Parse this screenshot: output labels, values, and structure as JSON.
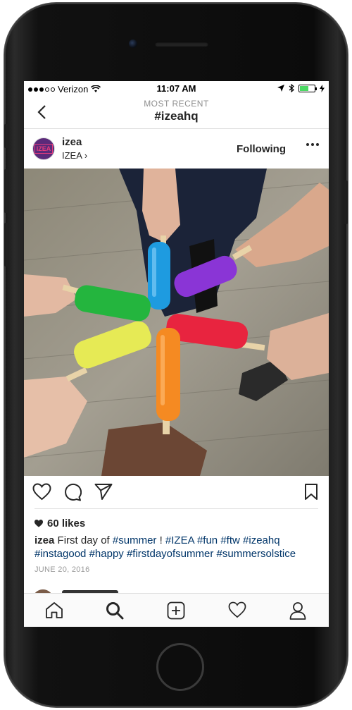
{
  "status_bar": {
    "carrier": "Verizon",
    "time": "11:07 AM",
    "battery_level": 0.6,
    "battery_color": "#4cd964"
  },
  "header": {
    "subtitle": "MOST RECENT",
    "title": "#izeahq",
    "back_icon": "chevron-left-icon"
  },
  "post": {
    "username": "izea",
    "location": "IZEA",
    "location_chevron": "›",
    "follow_label": "Following",
    "avatar_text": "IZEA",
    "likes": "60 likes",
    "caption_user": "izea",
    "caption_text": "First day of",
    "caption_parts": [
      {
        "text": "#summer",
        "tag": true
      },
      {
        "text": " ! ",
        "tag": false
      },
      {
        "text": "#IZEA",
        "tag": true
      },
      {
        "text": " ",
        "tag": false
      },
      {
        "text": "#fun",
        "tag": true
      },
      {
        "text": " ",
        "tag": false
      },
      {
        "text": "#ftw",
        "tag": true
      },
      {
        "text": " ",
        "tag": false
      },
      {
        "text": "#izeahq",
        "tag": true
      },
      {
        "text": " ",
        "tag": false
      },
      {
        "text": "#instagood",
        "tag": true
      },
      {
        "text": " ",
        "tag": false
      },
      {
        "text": "#happy",
        "tag": true
      },
      {
        "text": " ",
        "tag": false
      },
      {
        "text": "#firstdayofsummer",
        "tag": true
      },
      {
        "text": " ",
        "tag": false
      },
      {
        "text": "#summersolstice",
        "tag": true
      }
    ],
    "date": "JUNE 20, 2016",
    "hashtag_color": "#003569"
  },
  "tabs": [
    "home-icon",
    "search-icon",
    "add-post-icon",
    "activity-heart-icon",
    "profile-icon"
  ]
}
